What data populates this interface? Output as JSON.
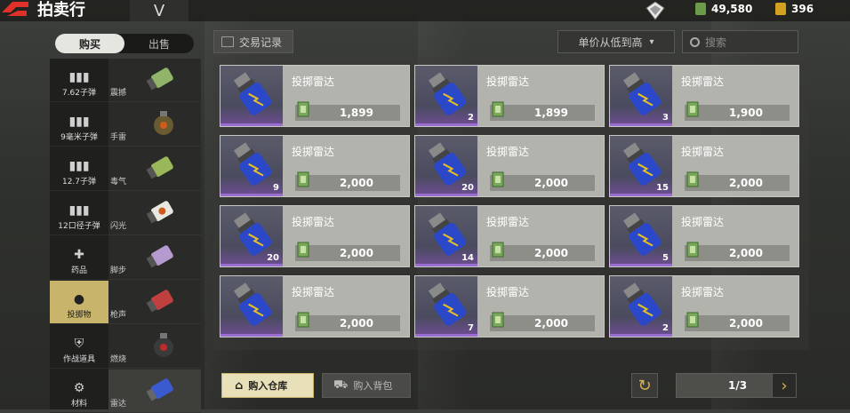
{
  "header": {
    "title": "拍卖行",
    "dropdown_glyph": "V",
    "currency": [
      {
        "icon": "cash-icon",
        "value": "49,580"
      },
      {
        "icon": "coupon-icon",
        "value": "396"
      }
    ]
  },
  "mode_tabs": [
    {
      "label": "购买",
      "active": true
    },
    {
      "label": "出售",
      "active": false
    }
  ],
  "categories": [
    {
      "label": "7.62子弹",
      "icon": "ammo-icon"
    },
    {
      "label": "9毫米子弹",
      "icon": "ammo-icon"
    },
    {
      "label": "12.7子弹",
      "icon": "ammo-icon"
    },
    {
      "label": "12口径子弹",
      "icon": "ammo-icon"
    },
    {
      "label": "药品",
      "icon": "medkit-icon"
    },
    {
      "label": "投掷物",
      "icon": "throwable-icon",
      "active": true
    },
    {
      "label": "作战道具",
      "icon": "shield-plus-icon"
    },
    {
      "label": "材料",
      "icon": "gear-icon"
    }
  ],
  "subcategories": [
    {
      "label": "震撼",
      "color": "#8fb46a"
    },
    {
      "label": "手雷",
      "color": "#7a6a3a"
    },
    {
      "label": "毒气",
      "color": "#9ab85a"
    },
    {
      "label": "闪光",
      "color": "#e8e8e0"
    },
    {
      "label": "脚步",
      "color": "#b59ad0"
    },
    {
      "label": "枪声",
      "color": "#c04040"
    },
    {
      "label": "燃烧",
      "color": "#9a2a2a"
    },
    {
      "label": "雷达",
      "color": "#3a5ad0",
      "active": true
    }
  ],
  "toolbar": {
    "trade_record": "交易记录",
    "sort_label": "单价从低到高",
    "search_placeholder": "搜索"
  },
  "items": [
    {
      "name": "投掷雷达",
      "qty": "",
      "price": "1,899"
    },
    {
      "name": "投掷雷达",
      "qty": "2",
      "price": "1,899"
    },
    {
      "name": "投掷雷达",
      "qty": "3",
      "price": "1,900"
    },
    {
      "name": "投掷雷达",
      "qty": "9",
      "price": "2,000"
    },
    {
      "name": "投掷雷达",
      "qty": "20",
      "price": "2,000"
    },
    {
      "name": "投掷雷达",
      "qty": "15",
      "price": "2,000"
    },
    {
      "name": "投掷雷达",
      "qty": "20",
      "price": "2,000"
    },
    {
      "name": "投掷雷达",
      "qty": "14",
      "price": "2,000"
    },
    {
      "name": "投掷雷达",
      "qty": "5",
      "price": "2,000"
    },
    {
      "name": "投掷雷达",
      "qty": "",
      "price": "2,000"
    },
    {
      "name": "投掷雷达",
      "qty": "7",
      "price": "2,000"
    },
    {
      "name": "投掷雷达",
      "qty": "2",
      "price": "2,000"
    }
  ],
  "footer": {
    "buy_to_warehouse": "购入仓库",
    "buy_to_backpack": "购入背包",
    "page": "1/3"
  },
  "colors": {
    "accent": "#c8b46a",
    "rarity": "#9a6ed0"
  }
}
